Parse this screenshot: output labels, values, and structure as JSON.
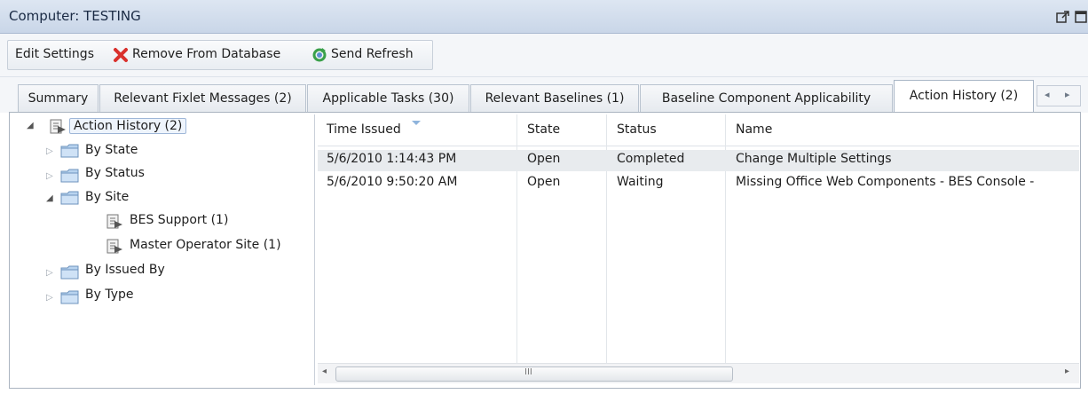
{
  "window": {
    "title": "Computer: TESTING"
  },
  "toolbar": {
    "edit_settings": "Edit Settings",
    "remove_from_database": "Remove From Database",
    "send_refresh": "Send Refresh"
  },
  "tabs": [
    {
      "label": "Summary"
    },
    {
      "label": "Relevant Fixlet Messages (2)"
    },
    {
      "label": "Applicable Tasks (30)"
    },
    {
      "label": "Relevant Baselines (1)"
    },
    {
      "label": "Baseline Component Applicability"
    },
    {
      "label": "Action History (2)",
      "active": true
    }
  ],
  "tree": {
    "root": "Action History (2)",
    "items": [
      {
        "label": "By State"
      },
      {
        "label": "By Status"
      },
      {
        "label": "By Site"
      },
      {
        "label": "BES Support (1)"
      },
      {
        "label": "Master Operator Site (1)"
      },
      {
        "label": "By Issued By"
      },
      {
        "label": "By Type"
      }
    ]
  },
  "grid": {
    "columns": [
      "Time Issued",
      "State",
      "Status",
      "Name"
    ],
    "rows": [
      {
        "time_issued": "5/6/2010 1:14:43 PM",
        "state": "Open",
        "status": "Completed",
        "name": "Change Multiple Settings"
      },
      {
        "time_issued": "5/6/2010 9:50:20 AM",
        "state": "Open",
        "status": "Waiting",
        "name": "Missing Office Web Components - BES Console -"
      }
    ]
  },
  "scrollbar": {
    "grip": "III"
  },
  "colors": {
    "titlebar": "#c9d6e8",
    "selection": "#e8ebee",
    "accent": "#4b7fc0"
  }
}
